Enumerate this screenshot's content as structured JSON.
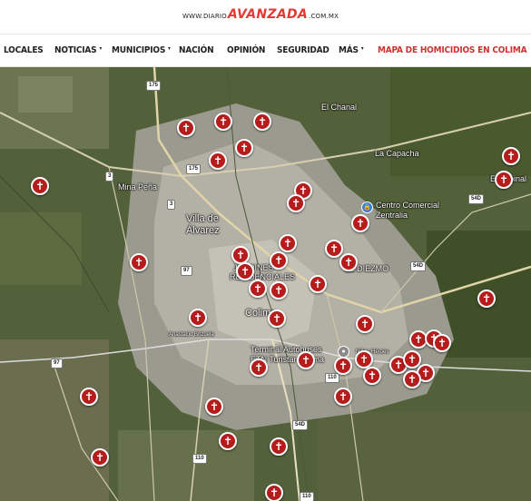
{
  "logo": {
    "prefix": "WWW.DIARIO",
    "brand": "AVANZADA",
    "suffix": ".COM.MX"
  },
  "nav": {
    "items": [
      {
        "label": "LOCALES",
        "caret": false
      },
      {
        "label": "NOTICIAS",
        "caret": true
      },
      {
        "label": "MUNICIPIOS",
        "caret": true
      },
      {
        "label": "NACIÓN",
        "caret": false
      },
      {
        "label": "OPINIÓN",
        "caret": false
      },
      {
        "label": "SEGURIDAD",
        "caret": false
      },
      {
        "label": "MÁS",
        "caret": true
      },
      {
        "label": "MAPA DE HOMICIDIOS EN COLIMA",
        "caret": false,
        "accent": true
      }
    ],
    "caret_glyph": "▾"
  },
  "map": {
    "labels": [
      {
        "id": "el-chanal",
        "text": "El Chanal"
      },
      {
        "id": "la-capacha",
        "text": "La Capacha"
      },
      {
        "id": "mina-pena",
        "text": "Mina Peña"
      },
      {
        "id": "villa-de-alvarez-1",
        "text": "Villa de"
      },
      {
        "id": "villa-de-alvarez-2",
        "text": "Álvarez"
      },
      {
        "id": "centro-comercial-1",
        "text": "Centro Comercial"
      },
      {
        "id": "centro-comercial-2",
        "text": "Zentralia"
      },
      {
        "id": "el-diezmo",
        "text": "EL DIEZMO"
      },
      {
        "id": "jardines-1",
        "text": "JARDINES"
      },
      {
        "id": "jardines-2",
        "text": "RESIDENCIALES"
      },
      {
        "id": "colima",
        "text": "Colima"
      },
      {
        "id": "terminal-1",
        "text": "Terminal Autobuses"
      },
      {
        "id": "terminal-2",
        "text": "ETN Turistar Colima"
      },
      {
        "id": "el-espinal",
        "text": "El Espinal"
      },
      {
        "id": "anastacio",
        "text": "Anastacio Brizuela"
      },
      {
        "id": "ninos-heroes",
        "text": "Niños Héroes"
      }
    ],
    "road_shields": [
      "175",
      "175",
      "3",
      "3",
      "97",
      "97",
      "54D",
      "54D",
      "54D",
      "110",
      "110",
      "110"
    ],
    "pin_glyph": "✝",
    "pin_color": "#b71c1c"
  }
}
